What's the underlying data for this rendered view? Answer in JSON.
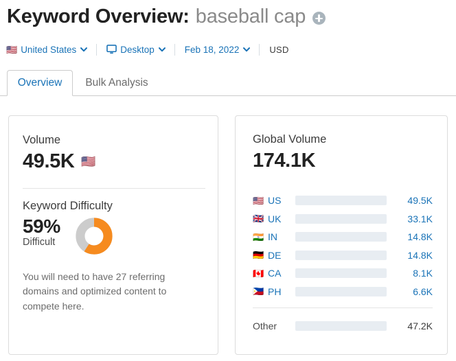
{
  "header": {
    "title_prefix": "Keyword Overview:",
    "keyword": "baseball cap",
    "add_icon": "plus-circle-icon"
  },
  "filters": {
    "country": {
      "flag": "🇺🇸",
      "label": "United States",
      "icon": "chevron-down-icon"
    },
    "device": {
      "icon": "monitor-icon",
      "label": "Desktop",
      "chevron": "chevron-down-icon"
    },
    "date": {
      "label": "Feb 18, 2022",
      "icon": "chevron-down-icon"
    },
    "currency": "USD"
  },
  "tabs": [
    {
      "label": "Overview",
      "active": true
    },
    {
      "label": "Bulk Analysis",
      "active": false
    }
  ],
  "volume_card": {
    "volume_label": "Volume",
    "volume_value": "49.5K",
    "volume_flag": "🇺🇸",
    "kd_label": "Keyword Difficulty",
    "kd_value": "59%",
    "kd_status": "Difficult",
    "kd_percent": 59,
    "kd_note": "You will need to have 27 referring domains and optimized content to compete here."
  },
  "global_card": {
    "title": "Global Volume",
    "value": "174.1K",
    "other_label": "Other",
    "other_value": "47.2K"
  },
  "chart_data": {
    "type": "bar",
    "title": "Global Volume",
    "orientation": "horizontal",
    "total": "174.1K",
    "total_value": 174100,
    "categories": [
      "US",
      "UK",
      "IN",
      "DE",
      "CA",
      "PH",
      "Other"
    ],
    "flags": [
      "🇺🇸",
      "🇬🇧",
      "🇮🇳",
      "🇩🇪",
      "🇨🇦",
      "🇵🇭",
      ""
    ],
    "values": [
      49500,
      33100,
      14800,
      14800,
      8100,
      6600,
      47200
    ],
    "value_labels": [
      "49.5K",
      "33.1K",
      "14.8K",
      "14.8K",
      "8.1K",
      "6.6K",
      "47.2K"
    ],
    "bar_percents": [
      37,
      25,
      11,
      11,
      6,
      5,
      35
    ],
    "colors": [
      "#1577c4",
      "#4eaaf5",
      "#4eaaf5",
      "#4eaaf5",
      "#4eaaf5",
      "#4eaaf5",
      "#4eaaf5"
    ],
    "track_color": "#e8edf2",
    "xlabel": "",
    "ylabel": "",
    "grid": false,
    "legend": false
  },
  "colors": {
    "link": "#1a73b7",
    "accent_orange": "#f68b1f",
    "donut_track": "#cccccc",
    "bar_primary": "#1577c4",
    "bar_secondary": "#4eaaf5"
  }
}
